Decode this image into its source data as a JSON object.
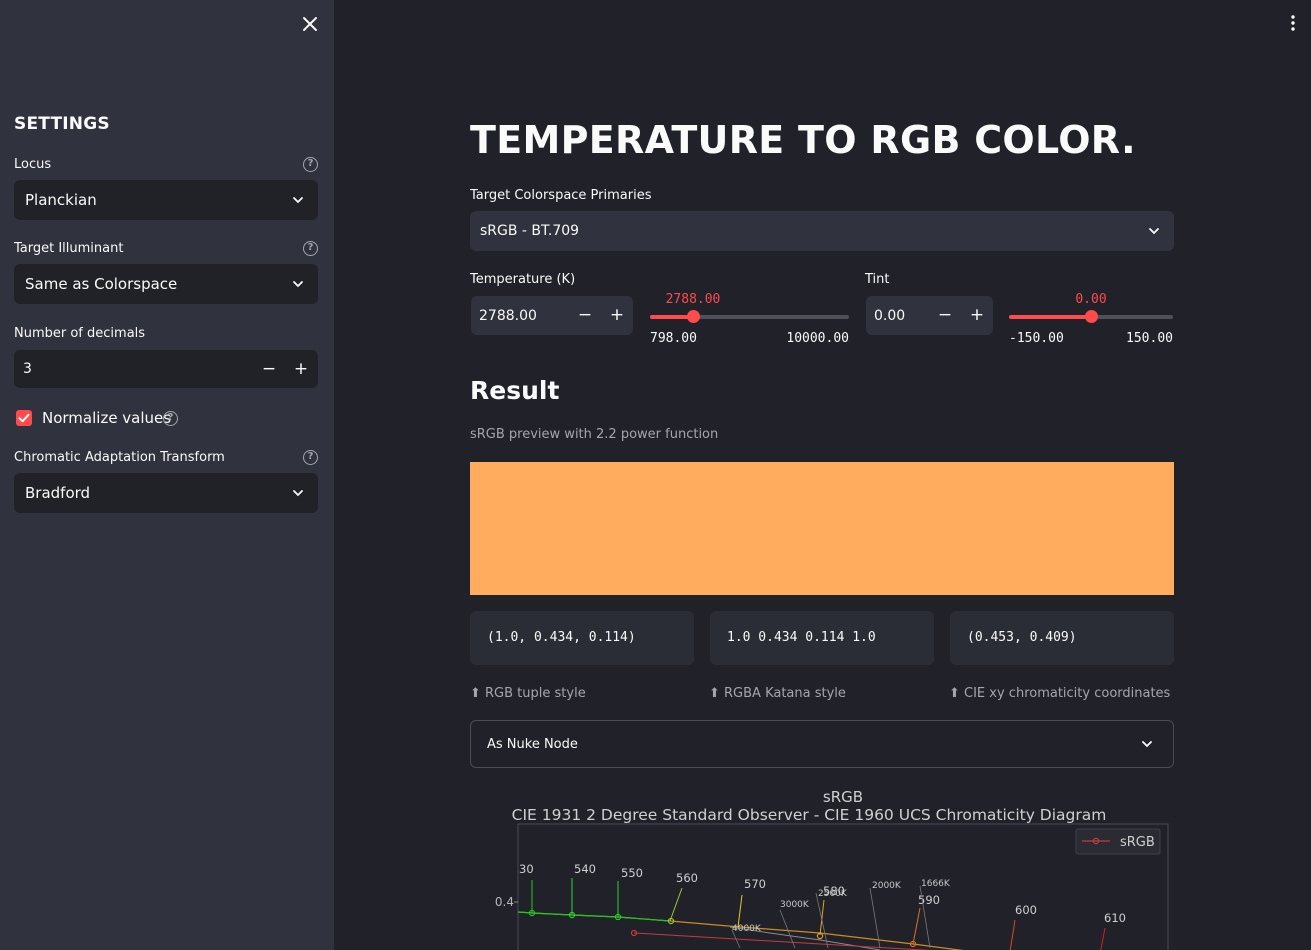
{
  "sidebar": {
    "title": "SETTINGS",
    "locus_label": "Locus",
    "locus_value": "Planckian",
    "illuminant_label": "Target Illuminant",
    "illuminant_value": "Same as Colorspace",
    "decimals_label": "Number of decimals",
    "decimals_value": "3",
    "normalize_label": "Normalize values",
    "normalize_checked": true,
    "cat_label": "Chromatic Adaptation Transform",
    "cat_value": "Bradford",
    "minus": "−",
    "plus": "+",
    "help": "?"
  },
  "main": {
    "title": "TEMPERATURE TO RGB COLOR.",
    "colorspace_label": "Target Colorspace Primaries",
    "colorspace_value": "sRGB - BT.709",
    "temperature_label": "Temperature (K)",
    "temperature_value": "2788.00",
    "temperature_slider": {
      "current": "2788.00",
      "min": "798.00",
      "max": "10000.00",
      "fraction": 0.2171
    },
    "tint_label": "Tint",
    "tint_value": "0.00",
    "tint_slider": {
      "current": "0.00",
      "min": "-150.00",
      "max": "150.00",
      "fraction": 0.5
    },
    "result_heading": "Result",
    "preview_caption": "sRGB preview with 2.2 power function",
    "swatch_color": "#ffac5e",
    "codes": [
      {
        "value": "(1.0, 0.434, 0.114)",
        "caption": "⬆ RGB tuple style"
      },
      {
        "value": "1.0 0.434 0.114 1.0",
        "caption": "⬆ RGBA Katana style"
      },
      {
        "value": "(0.453, 0.409)",
        "caption": "⬆ CIE xy chromaticity coordinates"
      }
    ],
    "nuke_expander": "As Nuke Node"
  },
  "chart_data": {
    "type": "line",
    "title": "sRGB",
    "subtitle": "CIE 1931 2 Degree Standard Observer - CIE 1960 UCS Chromaticity Diagram",
    "legend": "sRGB",
    "legend_position": "top-right",
    "y_tick_labels": [
      "0.4"
    ],
    "wavelength_labels": [
      "30",
      "540",
      "550",
      "560",
      "570",
      "580",
      "590",
      "600",
      "610"
    ],
    "temperature_labels": [
      "3000K",
      "2500K",
      "2000K",
      "1666K",
      "4000K"
    ],
    "colors": {
      "locus_green": "#22c722",
      "locus_yellow": "#e0b020",
      "locus_orange": "#e08a1e",
      "locus_red": "#e03030",
      "srgb": "#c43c3c"
    }
  },
  "colors": {
    "accent": "#ff4b4b",
    "sidebar_bg": "#30323d",
    "main_bg": "#202129"
  }
}
